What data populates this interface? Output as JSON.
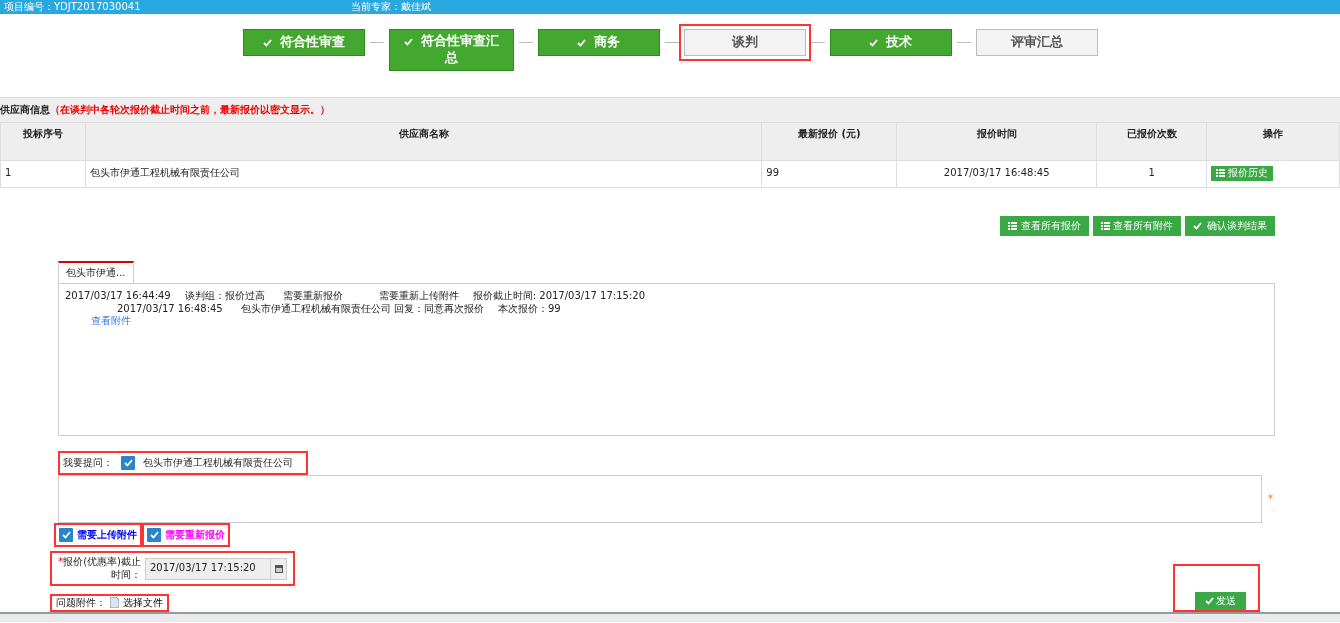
{
  "top_bar": {
    "project_no": "项目编号：YDJT2017030041",
    "expert": "当前专家：戴佳斌"
  },
  "steps": [
    {
      "label": "符合性审查",
      "done": true,
      "highlighted": false
    },
    {
      "label": "符合性审查汇总",
      "done": true,
      "highlighted": false
    },
    {
      "label": "商务",
      "done": true,
      "highlighted": false
    },
    {
      "label": "谈判",
      "done": false,
      "highlighted": true
    },
    {
      "label": "技术",
      "done": true,
      "highlighted": false
    },
    {
      "label": "评审汇总",
      "done": false,
      "highlighted": false
    }
  ],
  "supplier_section": {
    "title": "供应商信息",
    "notice": "（在谈判中各轮次报价截止时间之前，最新报价以密文显示。）"
  },
  "table": {
    "columns": [
      "投标序号",
      "供应商名称",
      "最新报价 (元)",
      "报价时间",
      "已报价次数",
      "操作"
    ],
    "rows": [
      {
        "cells": [
          "1",
          "包头市伊通工程机械有限责任公司",
          "99",
          "2017/03/17 16:48:45",
          "1"
        ],
        "action": "报价历史"
      }
    ]
  },
  "actions": [
    {
      "label": "查看所有报价",
      "kind": "list"
    },
    {
      "label": "查看所有附件",
      "kind": "list"
    },
    {
      "label": "确认谈判结果",
      "kind": "check"
    }
  ],
  "tabs": [
    {
      "label": "包头市伊通...",
      "selected": true
    }
  ],
  "messages": [
    {
      "kind": "question",
      "parts": [
        "2017/03/17 16:44:49",
        "谈判组：报价过高",
        "需要重新报价",
        "需要重新上传附件",
        "报价截止时间:  2017/03/17 17:15:20"
      ]
    },
    {
      "kind": "reply",
      "parts": [
        "2017/03/17 16:48:45",
        "包头市伊通工程机械有限责任公司  回复：同意再次报价",
        "本次报价：99"
      ]
    },
    {
      "kind": "link",
      "parts": [
        "查看附件"
      ]
    }
  ],
  "question": {
    "label": "我要提问：",
    "supplier": "包头市伊通工程机械有限责任公司",
    "checked": true,
    "highlighted": true,
    "required_mark": "*"
  },
  "options": [
    {
      "label": "需要上传附件",
      "checked": true,
      "color": "#0000ff",
      "highlighted": true
    },
    {
      "label": "需要重新报价",
      "checked": true,
      "color": "#ff00ff",
      "highlighted": true
    }
  ],
  "deadline": {
    "required_mark": "*",
    "label": "报价(优惠率)截止时间：",
    "value": "2017/03/17 17:15:20",
    "highlighted": true
  },
  "attachment": {
    "label": "问题附件：",
    "button": "选择文件",
    "highlighted": true
  },
  "send": {
    "label": "发送",
    "highlighted": true
  }
}
